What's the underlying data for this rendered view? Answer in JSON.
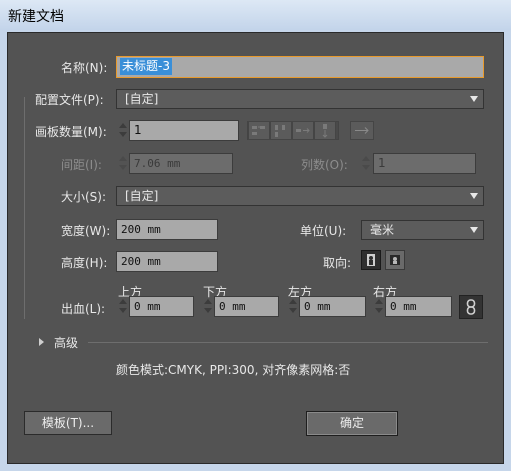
{
  "window": {
    "title": "新建文档"
  },
  "name": {
    "label": "名称(N):",
    "value": "未标题-3"
  },
  "profile": {
    "label": "配置文件(P):",
    "value": "[自定]"
  },
  "artboards": {
    "label": "画板数量(M):",
    "value": "1"
  },
  "spacing": {
    "label": "间距(I):",
    "value": "7.06 mm"
  },
  "columns": {
    "label": "列数(O):",
    "value": "1"
  },
  "size": {
    "label": "大小(S):",
    "value": "[自定]"
  },
  "width": {
    "label": "宽度(W):",
    "value": "200 mm"
  },
  "units": {
    "label": "单位(U):",
    "value": "毫米"
  },
  "height": {
    "label": "高度(H):",
    "value": "200 mm"
  },
  "orientation": {
    "label": "取向:"
  },
  "bleed": {
    "label": "出血(L):",
    "top_label": "上方",
    "top": "0 mm",
    "bottom_label": "下方",
    "bottom": "0 mm",
    "left_label": "左方",
    "left": "0 mm",
    "right_label": "右方",
    "right": "0 mm"
  },
  "advanced": {
    "label": "高级"
  },
  "info": {
    "text": "颜色模式:CMYK, PPI:300, 对齐像素网格:否"
  },
  "buttons": {
    "templates": "模板(T)...",
    "ok": "确定"
  }
}
